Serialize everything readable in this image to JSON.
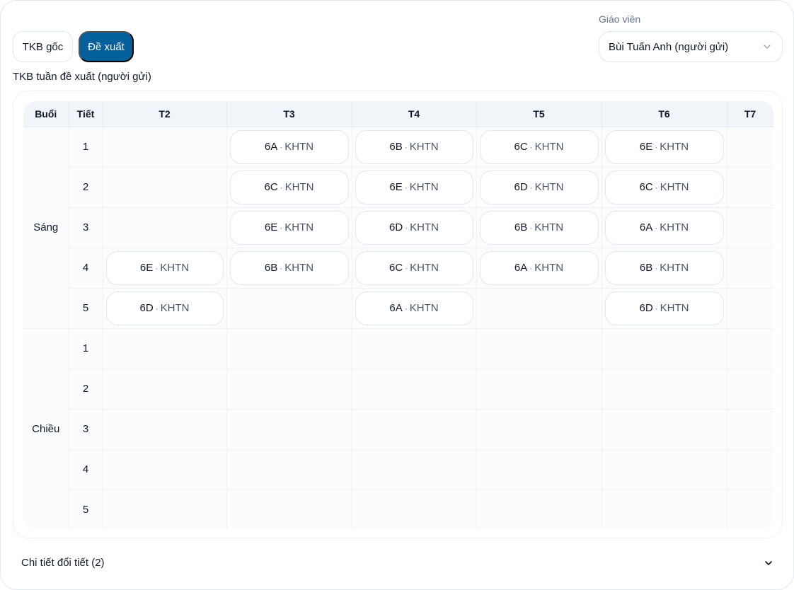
{
  "toolbar": {
    "original_label": "TKB gốc",
    "proposal_label": "Đề xuất"
  },
  "teacher": {
    "label": "Giáo viên",
    "selected": "Bùi Tuấn Anh (người gửi)"
  },
  "section_title": "TKB tuần đề xuất (người gửi)",
  "table": {
    "headers": [
      "Buổi",
      "Tiết",
      "T2",
      "T3",
      "T4",
      "T5",
      "T6",
      "T7"
    ],
    "sessions": [
      {
        "name": "Sáng",
        "rows": [
          {
            "period": "1",
            "cells": [
              "",
              "6A",
              "6B",
              "6C",
              "6E",
              ""
            ]
          },
          {
            "period": "2",
            "cells": [
              "",
              "6C",
              "6E",
              "6D",
              "6C",
              ""
            ]
          },
          {
            "period": "3",
            "cells": [
              "",
              "6E",
              "6D",
              "6B",
              "6A",
              ""
            ]
          },
          {
            "period": "4",
            "cells": [
              "6E",
              "6B",
              "6C",
              "6A",
              "6B",
              ""
            ]
          },
          {
            "period": "5",
            "cells": [
              "6D",
              "",
              "6A",
              "",
              "6D",
              ""
            ]
          }
        ]
      },
      {
        "name": "Chiều",
        "rows": [
          {
            "period": "1",
            "cells": [
              "",
              "",
              "",
              "",
              "",
              ""
            ]
          },
          {
            "period": "2",
            "cells": [
              "",
              "",
              "",
              "",
              "",
              ""
            ]
          },
          {
            "period": "3",
            "cells": [
              "",
              "",
              "",
              "",
              "",
              ""
            ]
          },
          {
            "period": "4",
            "cells": [
              "",
              "",
              "",
              "",
              "",
              ""
            ]
          },
          {
            "period": "5",
            "cells": [
              "",
              "",
              "",
              "",
              "",
              ""
            ]
          }
        ]
      }
    ],
    "subject": "KHTN",
    "separator": "·"
  },
  "details": {
    "label": "Chi tiết đổi tiết (2)"
  },
  "colors": {
    "accent": "#04609a",
    "muted_text": "#64748b"
  }
}
